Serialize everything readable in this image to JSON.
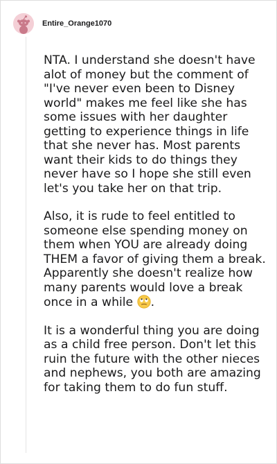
{
  "comment": {
    "username": "Entire_Orange1070",
    "avatar_icon": "reddit-snoo-avatar-icon",
    "paragraphs": [
      "NTA. I understand she doesn't have alot of money but the comment of \"I've never even been to Disney world\" makes me feel like she has some issues with her daughter getting to experience things in life that she never has. Most parents want their kids to do things they never have so I hope she still even let's you take her on that trip.",
      "Also, it is rude to feel entitled to someone else spending money on them when YOU are already doing THEM a favor of giving them a break. Apparently she doesn't realize how many parents would love a break once in a while",
      "It is a wonderful thing you are doing as a child free person. Don't let this ruin the future with the other nieces and nephews, you both are amazing for taking them to do fun stuff."
    ],
    "paragraph2_suffix": ".",
    "emoji_icon": "face-with-rolling-eyes-icon"
  },
  "colors": {
    "avatar_bg": "#f4cfd6",
    "text": "#1a1a1b",
    "border": "#dedede"
  }
}
